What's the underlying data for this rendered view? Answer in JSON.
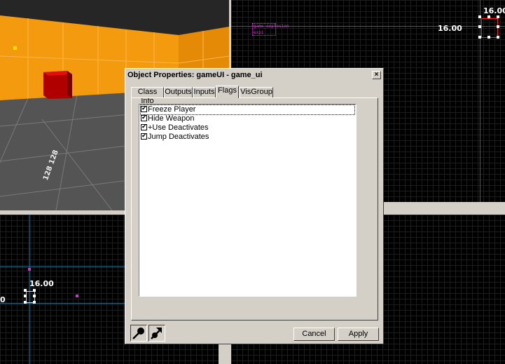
{
  "viewport_3d": {
    "marker_label": "128 128",
    "colors": {
      "wall": "#f39a0f",
      "floor": "#545454",
      "cube": "#c00000"
    }
  },
  "viewport_top_right": {
    "coord_label_top": "16.00",
    "coord_label_side": "16.00",
    "entity_label_1": "game_explosion",
    "entity_label_2": "exp1"
  },
  "viewport_bottom_left": {
    "coord_label": "16.00",
    "edge_label": "0"
  },
  "dialog": {
    "title": "Object Properties: gameUI - game_ui",
    "close_glyph": "×",
    "tabs": [
      {
        "label": "Class Info",
        "active": false
      },
      {
        "label": "Outputs",
        "active": false
      },
      {
        "label": "Inputs",
        "active": false
      },
      {
        "label": "Flags",
        "active": true
      },
      {
        "label": "VisGroup",
        "active": false
      }
    ],
    "flags": [
      {
        "label": "Freeze Player",
        "checked": true
      },
      {
        "label": "Hide Weapon",
        "checked": true
      },
      {
        "label": "+Use Deactivates",
        "checked": true
      },
      {
        "label": "Jump Deactivates",
        "checked": true
      }
    ],
    "check_glyph": "✔",
    "buttons": {
      "cancel": "Cancel",
      "apply": "Apply"
    },
    "icons": {
      "pick_entity": "eyedropper-icon",
      "pick_point": "arrow-point-icon"
    }
  }
}
